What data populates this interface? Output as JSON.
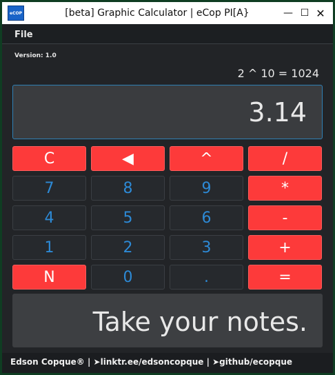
{
  "window": {
    "icon_text": "eCOP",
    "title": "[beta] Graphic Calculator | eCop PI[A}",
    "minimize_glyph": "—",
    "maximize_glyph": "☐",
    "close_glyph": "✕"
  },
  "menu": {
    "file": "File"
  },
  "version": "Version: 1.0",
  "history": "2 ^ 10 = 1024",
  "display_value": "3.14",
  "keys": {
    "clear": "C",
    "backspace": "◀",
    "power": "^",
    "divide": "/",
    "seven": "7",
    "eight": "8",
    "nine": "9",
    "multiply": "*",
    "four": "4",
    "five": "5",
    "six": "6",
    "subtract": "-",
    "one": "1",
    "two": "2",
    "three": "3",
    "add": "+",
    "negate": "N",
    "zero": "0",
    "decimal": ".",
    "equals": "="
  },
  "notes_placeholder": "Take your notes.",
  "footer": "Edson Copque® | ➤linktr.ee/edsoncopque | ➤github/ecopque",
  "colors": {
    "operator_key": "#fd3a3a",
    "digit_key_text": "#2d8ad6",
    "background": "#222427",
    "window_border": "#0f3d22"
  }
}
